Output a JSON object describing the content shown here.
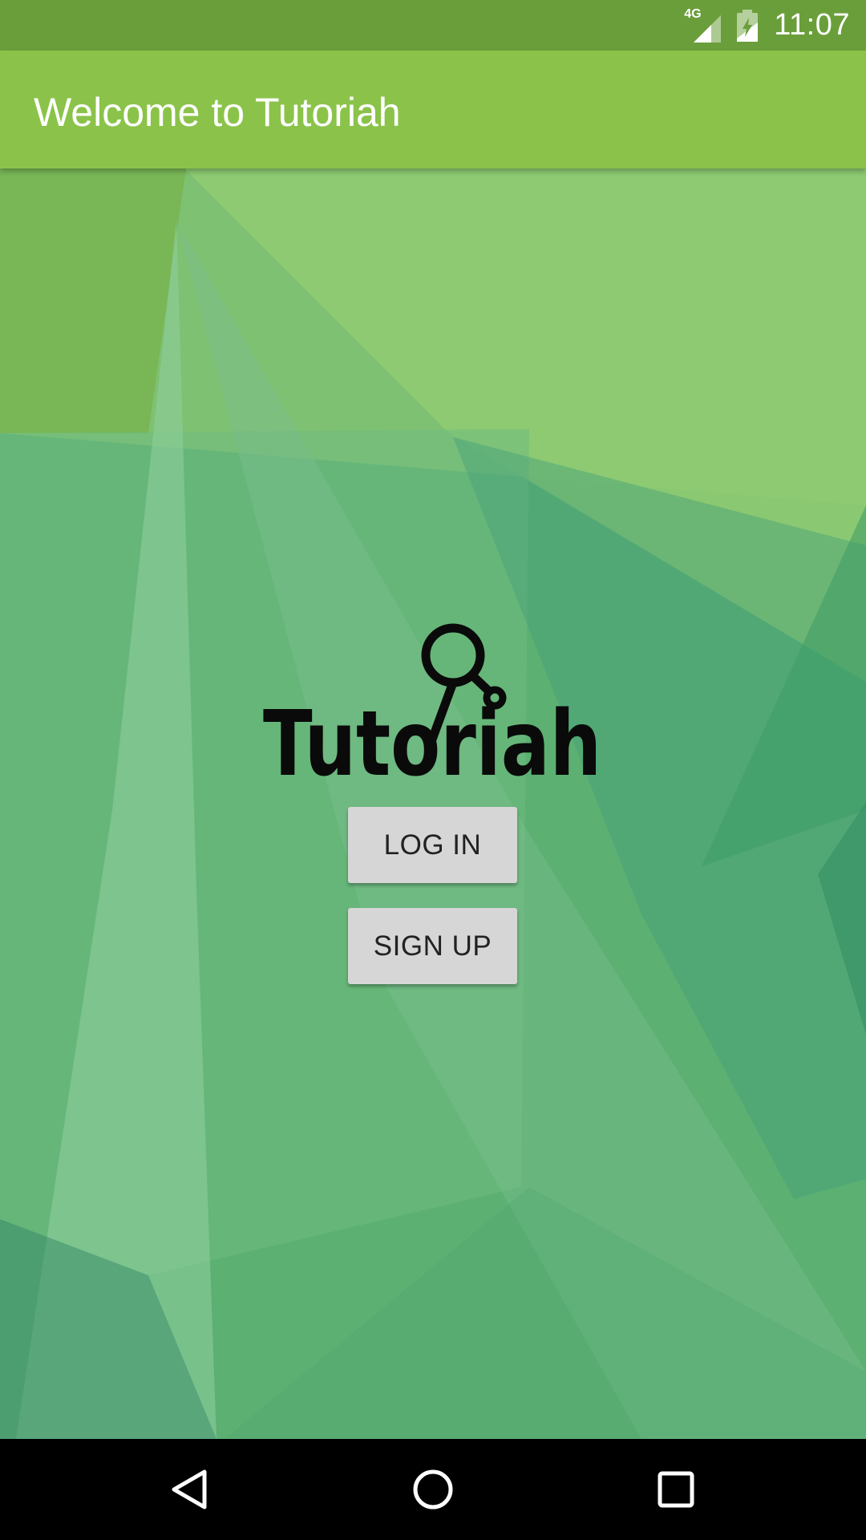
{
  "status_bar": {
    "network": "4G",
    "time": "11:07",
    "icons": [
      "signal-icon",
      "battery-charging-icon"
    ]
  },
  "app_bar": {
    "title": "Welcome to Tutoriah"
  },
  "logo": {
    "text": "Tutoriah"
  },
  "buttons": {
    "login": "LOG IN",
    "signup": "SIGN UP"
  },
  "nav_bar": {
    "icons": [
      "back-icon",
      "home-icon",
      "recents-icon"
    ]
  },
  "colors": {
    "status_bar": "#6a9e3a",
    "app_bar": "#8bc34a",
    "background": "#5aae6f",
    "button": "#d6d6d6"
  }
}
